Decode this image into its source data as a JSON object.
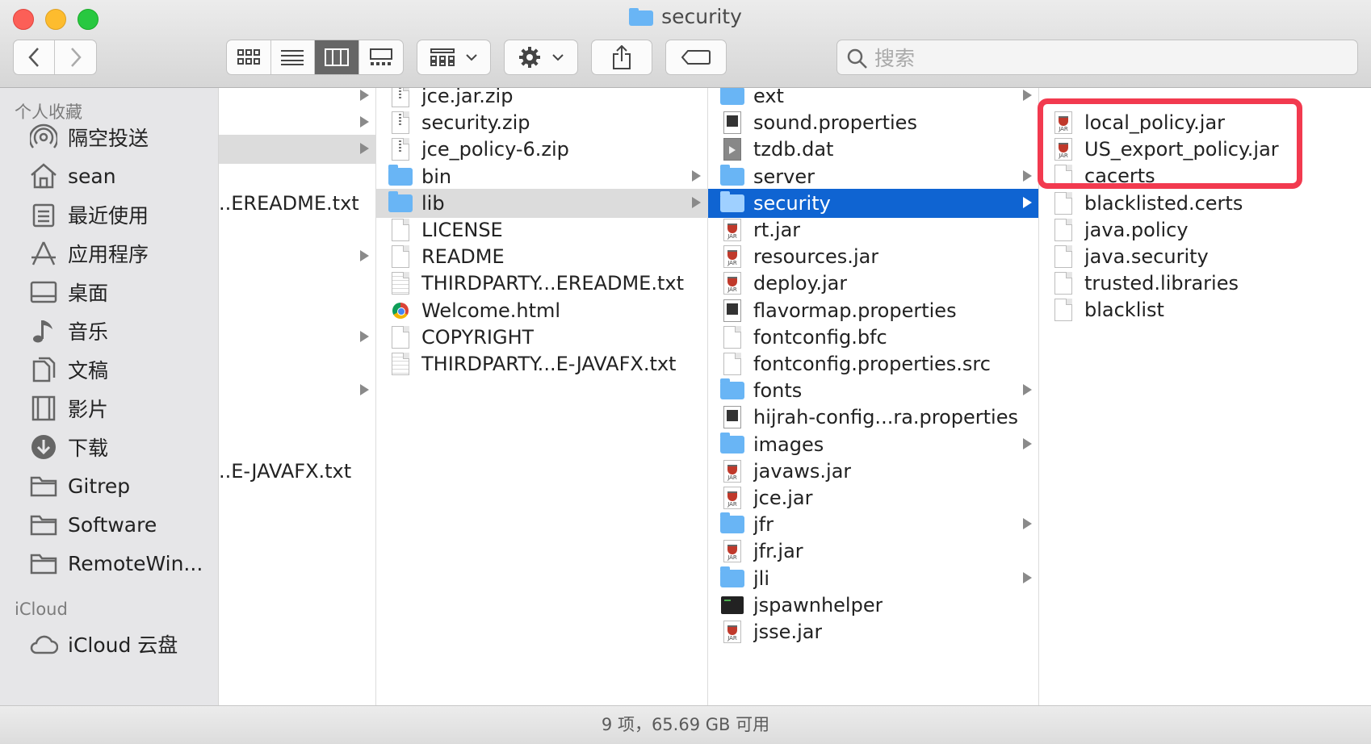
{
  "window": {
    "title": "security"
  },
  "toolbar": {
    "back": "back",
    "forward": "forward",
    "view_modes": [
      "icon",
      "list",
      "column",
      "gallery"
    ],
    "active_view": "column",
    "group_menu": "group",
    "action_menu": "action",
    "share": "share",
    "tags": "tags",
    "search_placeholder": "搜索"
  },
  "sidebar": {
    "favorites_header": "个人收藏",
    "favorites": [
      {
        "label": "隔空投送",
        "icon": "airdrop-icon"
      },
      {
        "label": "sean",
        "icon": "home-icon"
      },
      {
        "label": "最近使用",
        "icon": "recents-icon"
      },
      {
        "label": "应用程序",
        "icon": "applications-icon"
      },
      {
        "label": "桌面",
        "icon": "desktop-icon"
      },
      {
        "label": "音乐",
        "icon": "music-icon"
      },
      {
        "label": "文稿",
        "icon": "documents-icon"
      },
      {
        "label": "影片",
        "icon": "movies-icon"
      },
      {
        "label": "下载",
        "icon": "downloads-icon"
      },
      {
        "label": "Gitrep",
        "icon": "folder-icon"
      },
      {
        "label": "Software",
        "icon": "folder-icon"
      },
      {
        "label": "RemoteWin...",
        "icon": "folder-icon"
      }
    ],
    "icloud_header": "iCloud",
    "icloud": [
      {
        "label": "iCloud 云盘",
        "icon": "cloud-icon"
      }
    ]
  },
  "columns": {
    "col0": [
      {
        "name": "",
        "arrow": true
      },
      {
        "name": "",
        "arrow": true
      },
      {
        "name": "",
        "arrow": true,
        "selected": "gray"
      },
      {
        "name": "",
        "arrow": false
      },
      {
        "name": "..EREADME.txt",
        "arrow": false
      },
      {
        "name": "",
        "arrow": false
      },
      {
        "name": "",
        "arrow": true
      },
      {
        "name": "",
        "arrow": false
      },
      {
        "name": "",
        "arrow": false
      },
      {
        "name": "",
        "arrow": true
      },
      {
        "name": "",
        "arrow": false
      },
      {
        "name": "",
        "arrow": true
      },
      {
        "name": "",
        "arrow": false
      },
      {
        "name": "",
        "arrow": false
      },
      {
        "name": "..E-JAVAFX.txt",
        "arrow": false
      }
    ],
    "col1": [
      {
        "name": "jce.jar.zip",
        "icon": "zip"
      },
      {
        "name": "security.zip",
        "icon": "zip"
      },
      {
        "name": "jce_policy-6.zip",
        "icon": "zip"
      },
      {
        "name": "bin",
        "icon": "folder",
        "arrow": true
      },
      {
        "name": "lib",
        "icon": "folder",
        "arrow": true,
        "selected": "gray"
      },
      {
        "name": "LICENSE",
        "icon": "doc"
      },
      {
        "name": "README",
        "icon": "doc"
      },
      {
        "name": "THIRDPARTY...EREADME.txt",
        "icon": "lines"
      },
      {
        "name": "Welcome.html",
        "icon": "chrome"
      },
      {
        "name": "COPYRIGHT",
        "icon": "doc"
      },
      {
        "name": "THIRDPARTY...E-JAVAFX.txt",
        "icon": "lines"
      }
    ],
    "col2": [
      {
        "name": "ext",
        "icon": "folder",
        "arrow": true
      },
      {
        "name": "sound.properties",
        "icon": "props"
      },
      {
        "name": "tzdb.dat",
        "icon": "dat"
      },
      {
        "name": "server",
        "icon": "folder",
        "arrow": true
      },
      {
        "name": "security",
        "icon": "folder",
        "arrow": true,
        "selected": "blue"
      },
      {
        "name": "rt.jar",
        "icon": "jar"
      },
      {
        "name": "resources.jar",
        "icon": "jar"
      },
      {
        "name": "deploy.jar",
        "icon": "jar"
      },
      {
        "name": "flavormap.properties",
        "icon": "props"
      },
      {
        "name": "fontconfig.bfc",
        "icon": "doc"
      },
      {
        "name": "fontconfig.properties.src",
        "icon": "doc"
      },
      {
        "name": "fonts",
        "icon": "folder",
        "arrow": true
      },
      {
        "name": "hijrah-config...ra.properties",
        "icon": "props"
      },
      {
        "name": "images",
        "icon": "folder",
        "arrow": true
      },
      {
        "name": "javaws.jar",
        "icon": "jar"
      },
      {
        "name": "jce.jar",
        "icon": "jar"
      },
      {
        "name": "jfr",
        "icon": "folder",
        "arrow": true
      },
      {
        "name": "jfr.jar",
        "icon": "jar"
      },
      {
        "name": "jli",
        "icon": "folder",
        "arrow": true
      },
      {
        "name": "jspawnhelper",
        "icon": "term"
      },
      {
        "name": "jsse.jar",
        "icon": "jar"
      }
    ],
    "col3": [
      {
        "name": "local_policy.jar",
        "icon": "jar"
      },
      {
        "name": "US_export_policy.jar",
        "icon": "jar"
      },
      {
        "name": "cacerts",
        "icon": "doc"
      },
      {
        "name": "blacklisted.certs",
        "icon": "doc"
      },
      {
        "name": "java.policy",
        "icon": "doc"
      },
      {
        "name": "java.security",
        "icon": "doc"
      },
      {
        "name": "trusted.libraries",
        "icon": "doc"
      },
      {
        "name": "blacklist",
        "icon": "doc"
      }
    ]
  },
  "status": {
    "text": "9 项，65.69 GB 可用"
  },
  "colors": {
    "selection_blue": "#0f64d2",
    "highlight_red": "#f23a4f",
    "folder_blue": "#69b5f5"
  }
}
